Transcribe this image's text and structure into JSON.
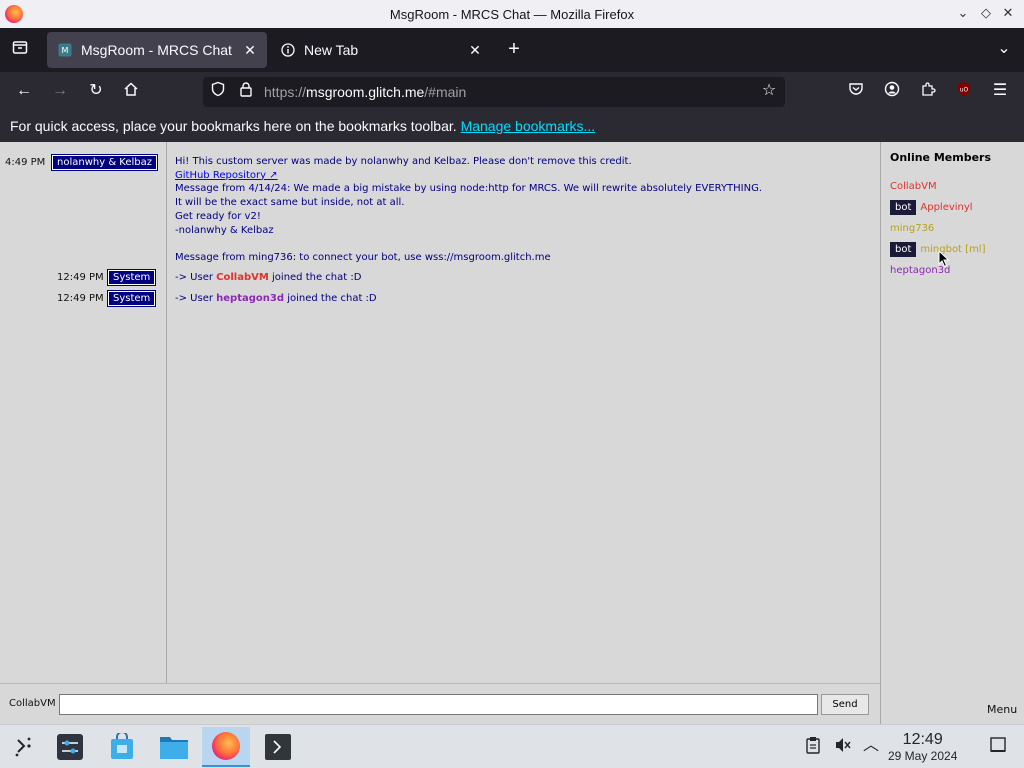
{
  "window": {
    "title": "MsgRoom - MRCS Chat — Mozilla Firefox"
  },
  "tabs": [
    {
      "label": "MsgRoom - MRCS Chat",
      "active": true
    },
    {
      "label": "New Tab",
      "active": false
    }
  ],
  "urlbar": {
    "prefix": "https://",
    "host": "msgroom.glitch.me",
    "path": "/#main"
  },
  "bookmarks_bar": {
    "text": "For quick access, place your bookmarks here on the bookmarks toolbar.",
    "link": "Manage bookmarks..."
  },
  "chat": {
    "messages": [
      {
        "time": "4:49 PM",
        "sender": "nolanwhy & Kelbaz",
        "lines": [
          "Hi! This custom server was made by nolanwhy and Kelbaz. Please don't remove this credit.",
          "GitHub Repository ↗",
          "Message from 4/14/24: We made a big mistake by using node:http for MRCS. We will rewrite absolutely EVERYTHING.",
          "It will be the exact same but inside, not at all.",
          "Get ready for v2!",
          "-nolanwhy & Kelbaz",
          "",
          "Message from ming736: to connect your bot, use wss://msgroom.glitch.me"
        ]
      },
      {
        "time": "12:49 PM",
        "sender": "System",
        "prefix": "-> User",
        "user": "CollabVM",
        "suffix": "joined the chat :D"
      },
      {
        "time": "12:49 PM",
        "sender": "System",
        "prefix": "-> User",
        "user": "heptagon3d",
        "suffix": "joined the chat :D"
      }
    ]
  },
  "members": {
    "title": "Online Members",
    "list": [
      {
        "name": "CollabVM",
        "bot": false,
        "color": "#e0322e"
      },
      {
        "name": "Applevinyl",
        "bot": true,
        "bot_label": "bot",
        "color": "#e0322e"
      },
      {
        "name": "ming736",
        "bot": false,
        "color": "#b8a11e"
      },
      {
        "name": "mingbot [ml]",
        "bot": true,
        "bot_label": "bot",
        "color": "#b8a11e"
      },
      {
        "name": "heptagon3d",
        "bot": false,
        "color": "#8e28b3"
      }
    ]
  },
  "composer": {
    "username": "CollabVM",
    "input_value": "",
    "send_label": "Send"
  },
  "menu_label": "Menu",
  "clock": {
    "time": "12:49",
    "date": "29 May 2024"
  },
  "colors": {
    "badge_bg": "#000080",
    "message_text": "#000080",
    "page_bg": "#d8d8d8"
  }
}
